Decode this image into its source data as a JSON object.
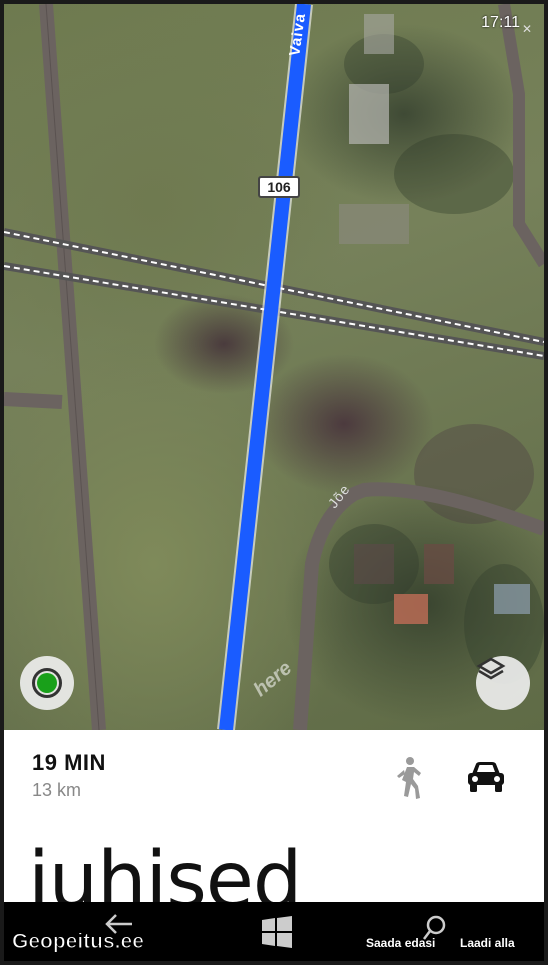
{
  "status": {
    "time": "17:11",
    "close_glyph": "✕"
  },
  "map": {
    "road_label_main": "Vaiva",
    "road_label_side": "Jõe",
    "road_number": "106",
    "provider_logo": "here",
    "route_color": "#1a5cff",
    "locate_icon": "locate-icon",
    "layers_icon": "layers-icon"
  },
  "route": {
    "duration": "19 MIN",
    "distance": "13 km",
    "modes": [
      "walk-icon",
      "car-icon"
    ]
  },
  "directions": {
    "title": "juhised"
  },
  "appbar": {
    "share_label": "Saada edasi",
    "download_label": "Laadi alla",
    "watermark": "Geopeitus.ee"
  }
}
